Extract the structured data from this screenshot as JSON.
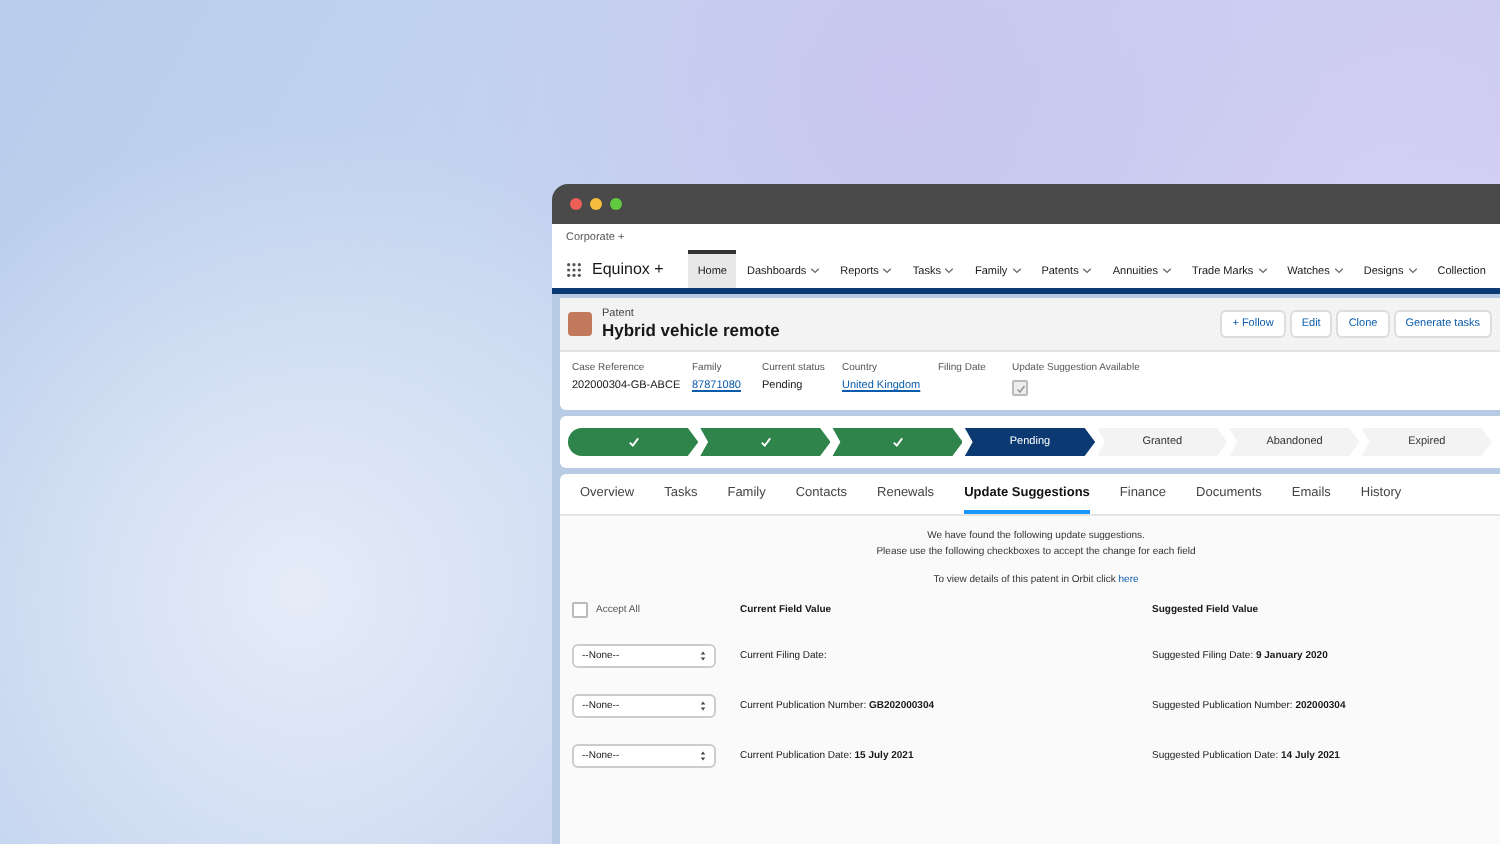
{
  "app": {
    "org": "Corporate +",
    "name": "Equinox +"
  },
  "nav": [
    {
      "label": "Home",
      "selected": true,
      "dropdown": false
    },
    {
      "label": "Dashboards",
      "selected": false,
      "dropdown": true
    },
    {
      "label": "Reports",
      "selected": false,
      "dropdown": true
    },
    {
      "label": "Tasks",
      "selected": false,
      "dropdown": true
    },
    {
      "label": "Family",
      "selected": false,
      "dropdown": true
    },
    {
      "label": "Patents",
      "selected": false,
      "dropdown": true
    },
    {
      "label": "Annuities",
      "selected": false,
      "dropdown": true
    },
    {
      "label": "Trade Marks",
      "selected": false,
      "dropdown": true
    },
    {
      "label": "Watches",
      "selected": false,
      "dropdown": true
    },
    {
      "label": "Designs",
      "selected": false,
      "dropdown": true
    },
    {
      "label": "Collection",
      "selected": false,
      "dropdown": false
    }
  ],
  "record": {
    "type": "Patent",
    "title": "Hybrid vehicle remote",
    "actions": [
      "+ Follow",
      "Edit",
      "Clone",
      "Generate tasks"
    ]
  },
  "details": [
    {
      "label": "Case Reference",
      "value": "202000304-GB-ABCE",
      "kind": "text"
    },
    {
      "label": "Family",
      "value": "87871080",
      "kind": "link"
    },
    {
      "label": "Current status",
      "value": "Pending",
      "kind": "text"
    },
    {
      "label": "Country",
      "value": "United Kingdom",
      "kind": "link"
    },
    {
      "label": "Filing Date",
      "kind": "text"
    },
    {
      "label": "Update Suggestion Available",
      "kind": "checkbox",
      "checked": true
    }
  ],
  "path": [
    {
      "kind": "complete"
    },
    {
      "kind": "complete"
    },
    {
      "kind": "complete"
    },
    {
      "label": "Pending",
      "kind": "current"
    },
    {
      "label": "Granted",
      "kind": "upcoming"
    },
    {
      "label": "Abandoned",
      "kind": "upcoming"
    },
    {
      "label": "Expired",
      "kind": "upcoming"
    }
  ],
  "tabs": [
    {
      "label": "Overview",
      "selected": false
    },
    {
      "label": "Tasks",
      "selected": false
    },
    {
      "label": "Family",
      "selected": false
    },
    {
      "label": "Contacts",
      "selected": false
    },
    {
      "label": "Renewals",
      "selected": false
    },
    {
      "label": "Update Suggestions",
      "selected": true
    },
    {
      "label": "Finance",
      "selected": false
    },
    {
      "label": "Documents",
      "selected": false
    },
    {
      "label": "Emails",
      "selected": false
    },
    {
      "label": "History",
      "selected": false
    }
  ],
  "intro": [
    "We have found the following update suggestions.",
    "Please use the following checkboxes to accept the change for each field"
  ],
  "orbit": {
    "text": "To view details of this patent in Orbit click",
    "link": "here"
  },
  "accept_all": {
    "label": "Accept All",
    "checked": false
  },
  "columns": [
    "Current Field Value",
    "Suggested Field Value"
  ],
  "suggestions": [
    {
      "select": "--None--",
      "current": "Current Filing Date:",
      "suggested": "Suggested Filing Date: **9 January 2020**"
    },
    {
      "select": "--None--",
      "current": "Current Publication Number: **GB202000304**",
      "suggested": "Suggested Publication Number: **202000304**"
    },
    {
      "select": "--None--",
      "current": "Current Publication Date: **15 July 2021**",
      "suggested": "Suggested Publication Date: **14 July 2021**"
    }
  ]
}
